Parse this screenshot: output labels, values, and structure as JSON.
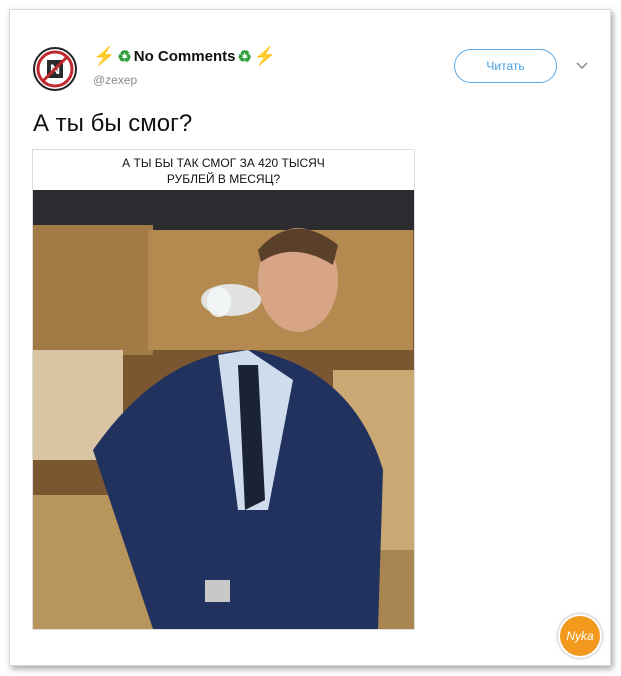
{
  "account": {
    "display_name": "No Comments",
    "handle": "@zexep",
    "avatar_icon": "no-comments-logo-icon"
  },
  "follow_button": {
    "label": "Читать"
  },
  "menu_icon": "chevron-down-icon",
  "tweet": {
    "text": "А ты бы смог?"
  },
  "media": {
    "caption_line1": "А ТЫ БЫ ТАК СМОГ ЗА 420 ТЫСЯЧ",
    "caption_line2": "РУБЛЕЙ В МЕСЯЦ?"
  },
  "watermark": {
    "text": "Nyka"
  },
  "colors": {
    "accent": "#4aa0e0",
    "bolt": "#f5b400",
    "recycle": "#2e9e3a",
    "watermark": "#f39a1e"
  }
}
